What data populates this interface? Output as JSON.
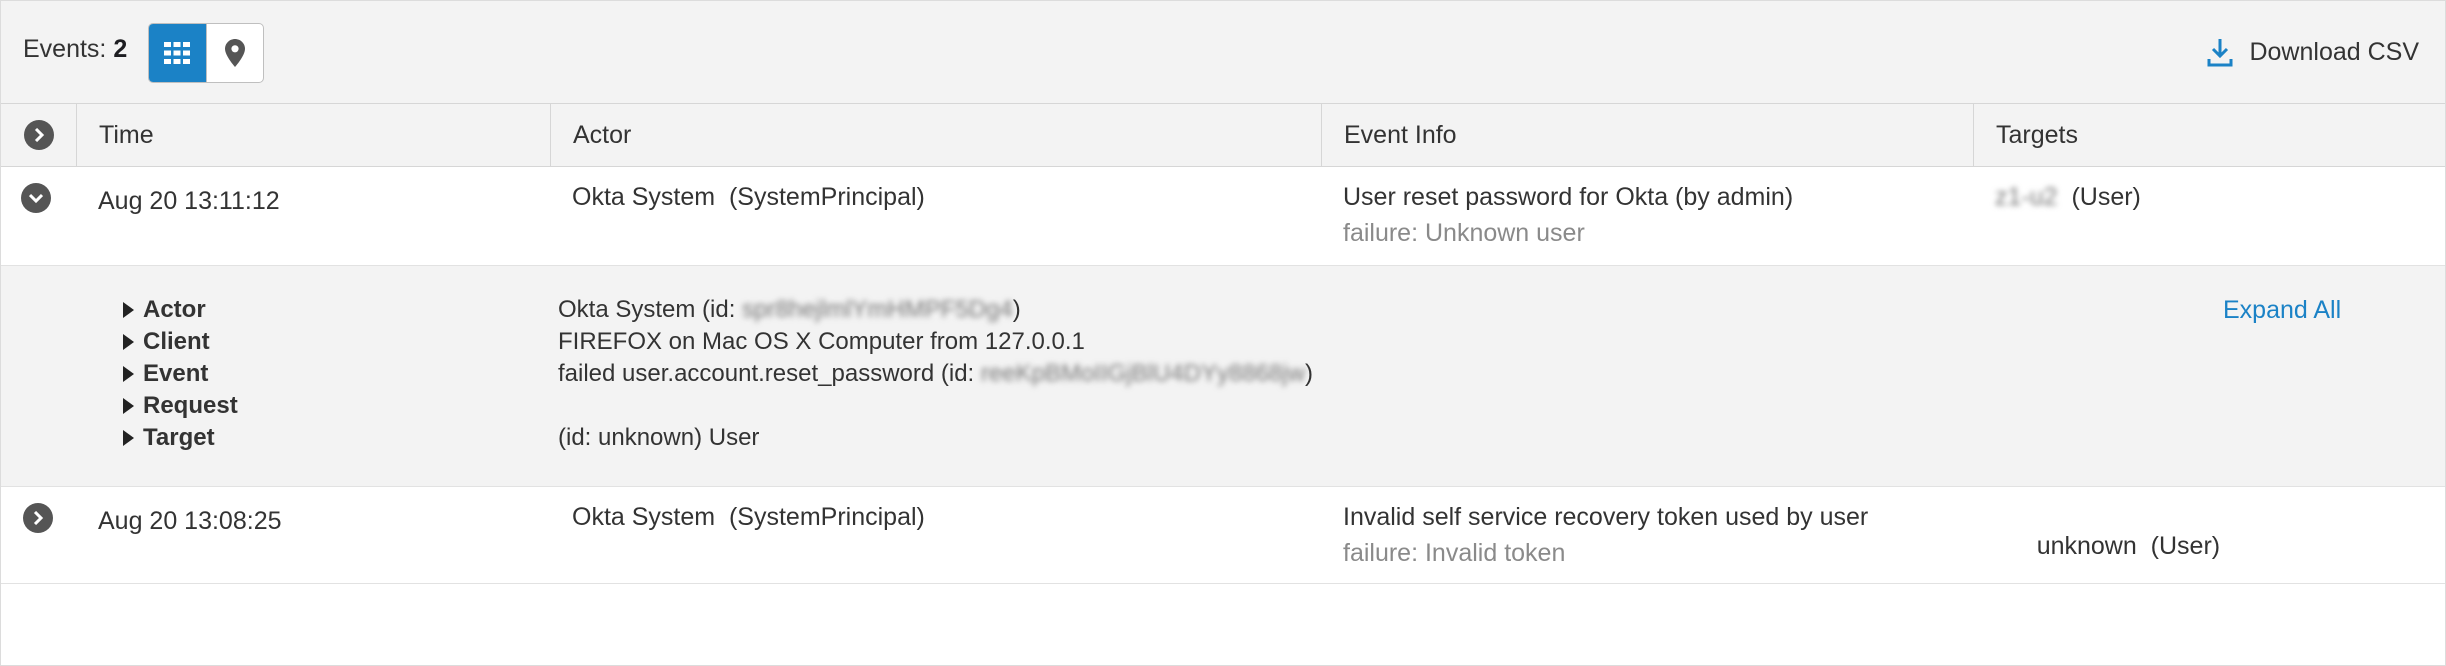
{
  "toolbar": {
    "events_label": "Events:",
    "events_count": "2",
    "grid_view_icon": "grid-icon",
    "map_view_icon": "map-pin-icon",
    "download_label": "Download CSV",
    "download_icon": "download-icon",
    "accent_color": "#1b82c6"
  },
  "table": {
    "headers": {
      "time": "Time",
      "actor": "Actor",
      "event_info": "Event Info",
      "targets": "Targets"
    },
    "rows": [
      {
        "time": "Aug 20 13:11:12",
        "actor": "Okta System  (SystemPrincipal)",
        "event": "User reset password for Okta (by admin)",
        "event_sub": "failure: Unknown user",
        "target_name": "z1-u2",
        "target_type": "(User)",
        "expanded": true
      },
      {
        "time": "Aug 20 13:08:25",
        "actor": "Okta System  (SystemPrincipal)",
        "event": "Invalid self service recovery token used by user",
        "event_sub": "failure: Invalid token",
        "target_name": "unknown",
        "target_type": "(User)",
        "expanded": false
      }
    ]
  },
  "details": {
    "expand_all": "Expand All",
    "items": [
      {
        "label": "Actor",
        "prefix": "Okta System (id: ",
        "redacted": "spr8hejlmlYmHMPF5Dg4",
        "suffix": ")"
      },
      {
        "label": "Client",
        "prefix": "FIREFOX on Mac OS X Computer from 127.0.0.1",
        "redacted": "",
        "suffix": ""
      },
      {
        "label": "Event",
        "prefix": "failed user.account.reset_password (id: ",
        "redacted": "reeKpBMoIIGjBlU4DYy8868jw",
        "suffix": ")"
      },
      {
        "label": "Request",
        "prefix": "",
        "redacted": "",
        "suffix": ""
      },
      {
        "label": "Target",
        "prefix": "(id: unknown) User",
        "redacted": "",
        "suffix": ""
      }
    ]
  }
}
